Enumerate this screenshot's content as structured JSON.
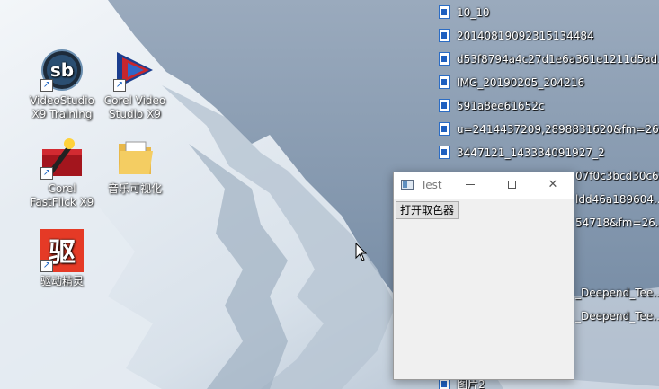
{
  "desktop": {
    "icons": [
      {
        "label": "VideoStudio X9 Training",
        "icon": "corel-videostudio-training-icon"
      },
      {
        "label": "Corel Video Studio X9",
        "icon": "corel-videostudio-icon"
      },
      {
        "label": "Corel FastFlick X9",
        "icon": "corel-fastflick-icon"
      },
      {
        "label": "音乐可视化",
        "icon": "folder-icon"
      },
      {
        "label": "驱动精灵",
        "icon": "driver-genius-icon"
      }
    ],
    "files": [
      "10_10",
      "20140819092315134484",
      "d53f8794a4c27d1e6a361e1211d5ad...",
      "IMG_20190205_204216",
      "591a8ee61652c",
      "u=2414437209,2898831620&fm=26...",
      "3447121_143334091927_2",
      "07f0c3bcd30c6...",
      "ldd46a189604...",
      "54718&fm=26...",
      "_Deepend_Tee...",
      "_Deepend_Tee...",
      "图片2"
    ]
  },
  "window": {
    "title": "Test",
    "minimize": "minimize",
    "maximize": "maximize",
    "close": "✕",
    "button_label": "打开取色器"
  },
  "colors": {
    "window_bg": "#f0f0f0",
    "titlebar_bg": "#ffffff",
    "button_bg": "#e1e1e1"
  }
}
